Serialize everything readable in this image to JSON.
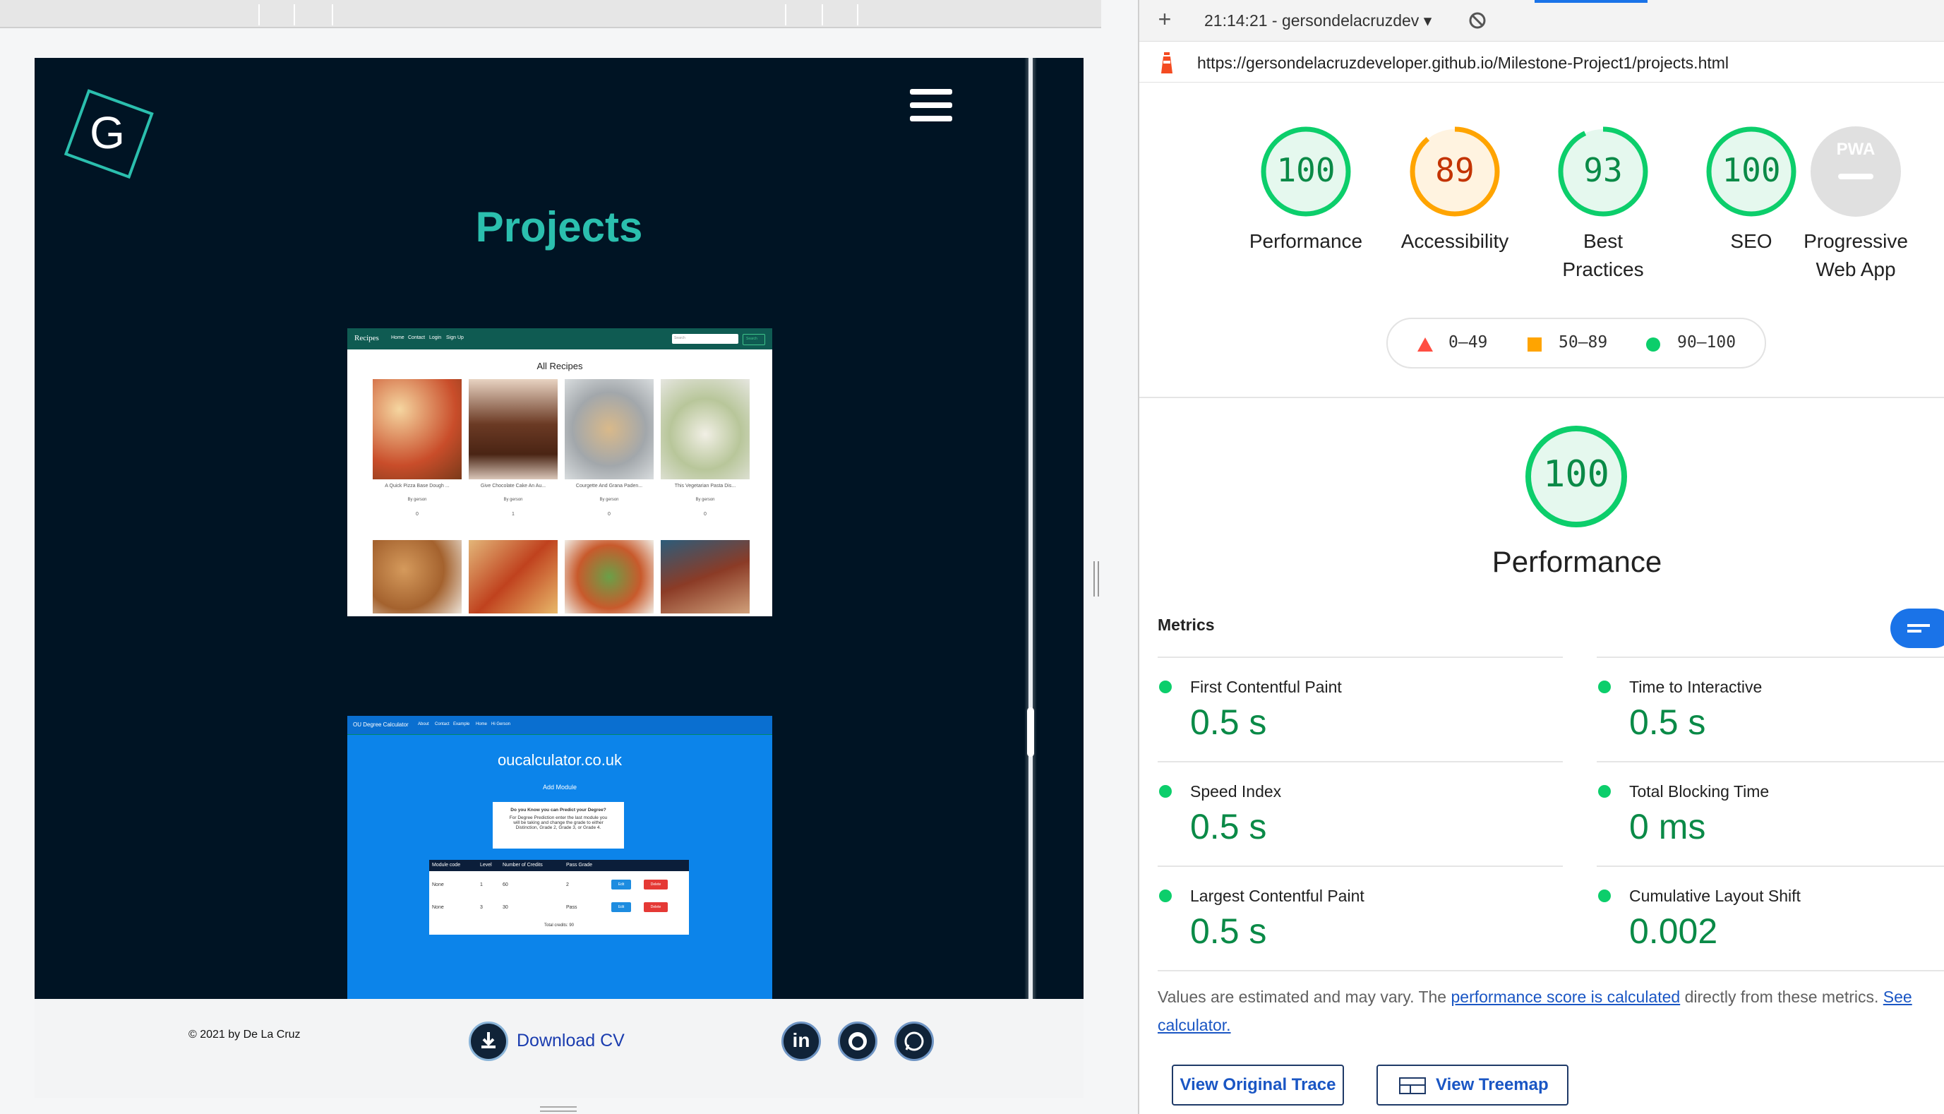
{
  "site": {
    "logo_letter": "G",
    "title": "Projects",
    "recipes": {
      "brand": "Recipes",
      "nav": [
        "Home",
        "Contact",
        "Login",
        "Sign Up"
      ],
      "search_placeholder": "Search",
      "search_button": "Search",
      "heading": "All Recipes",
      "cards": [
        {
          "title": "A Quick Pizza Base Dough ...",
          "author": "By gerson",
          "count": "0"
        },
        {
          "title": "Give Chocolate Cake An Au...",
          "author": "By gerson",
          "count": "1"
        },
        {
          "title": "Courgette And Grana Paden...",
          "author": "By gerson",
          "count": "0"
        },
        {
          "title": "This Vegetarian Pasta Dis...",
          "author": "By gerson",
          "count": "0"
        }
      ]
    },
    "calculator": {
      "brand": "OU Degree Calculator",
      "nav": [
        "About",
        "Contact",
        "Example",
        "Home",
        "Hi Gerson"
      ],
      "title": "oucalculator.co.uk",
      "add_module": "Add Module",
      "info_title": "Do you Know you can Predict your Degree?",
      "info_lines": [
        "For Degree Prediction enter the last module you",
        "will be taking and change the grade to either",
        "Distinction, Grade 2, Grade 3, or Grade 4."
      ],
      "headers": [
        "Module code",
        "Level",
        "Number of Credits",
        "Pass Grade"
      ],
      "rows": [
        {
          "code": "None",
          "level": "1",
          "credits": "60",
          "grade": "2"
        },
        {
          "code": "None",
          "level": "3",
          "credits": "30",
          "grade": "Pass"
        }
      ],
      "edit_label": "Edit",
      "delete_label": "Delete",
      "total": "Total credits: 90"
    },
    "footer": {
      "copyright": "© 2021 by De La Cruz",
      "download": "Download CV",
      "social": [
        "linkedin-icon",
        "github-icon",
        "whatsapp-icon"
      ]
    }
  },
  "devtools": {
    "report_select": "21:14:21 - gersondelacruzdev ▾",
    "url": "https://gersondelacruzdeveloper.github.io/Milestone-Project1/projects.html",
    "scores": [
      {
        "value": 100,
        "label1": "Performance",
        "label2": "",
        "color": "#0cce6b",
        "text_color": "#0a8a47",
        "bg": "#e5f8ee"
      },
      {
        "value": 89,
        "label1": "Accessibility",
        "label2": "",
        "color": "#ffa400",
        "text_color": "#c33300",
        "bg": "#fff3e0"
      },
      {
        "value": 93,
        "label1": "Best",
        "label2": "Practices",
        "color": "#0cce6b",
        "text_color": "#0a8a47",
        "bg": "#e5f8ee"
      },
      {
        "value": 100,
        "label1": "SEO",
        "label2": "",
        "color": "#0cce6b",
        "text_color": "#0a8a47",
        "bg": "#e5f8ee"
      }
    ],
    "pwa": {
      "badge": "PWA",
      "label1": "Progressive",
      "label2": "Web App"
    },
    "legend": [
      "0–49",
      "50–89",
      "90–100"
    ],
    "performance": {
      "score": "100",
      "label": "Performance"
    },
    "metrics_title": "Metrics",
    "metrics": [
      {
        "name": "First Contentful Paint",
        "value": "0.5 s"
      },
      {
        "name": "Time to Interactive",
        "value": "0.5 s"
      },
      {
        "name": "Speed Index",
        "value": "0.5 s"
      },
      {
        "name": "Total Blocking Time",
        "value": "0 ms"
      },
      {
        "name": "Largest Contentful Paint",
        "value": "0.5 s"
      },
      {
        "name": "Cumulative Layout Shift",
        "value": "0.002"
      }
    ],
    "disclaimer": {
      "text1": "Values are estimated and may vary. The ",
      "link1": "performance score is calculated",
      "text2": " directly from these metrics. ",
      "link2": "See calculator."
    },
    "buttons": {
      "trace": "View Original Trace",
      "treemap": "View Treemap"
    }
  }
}
